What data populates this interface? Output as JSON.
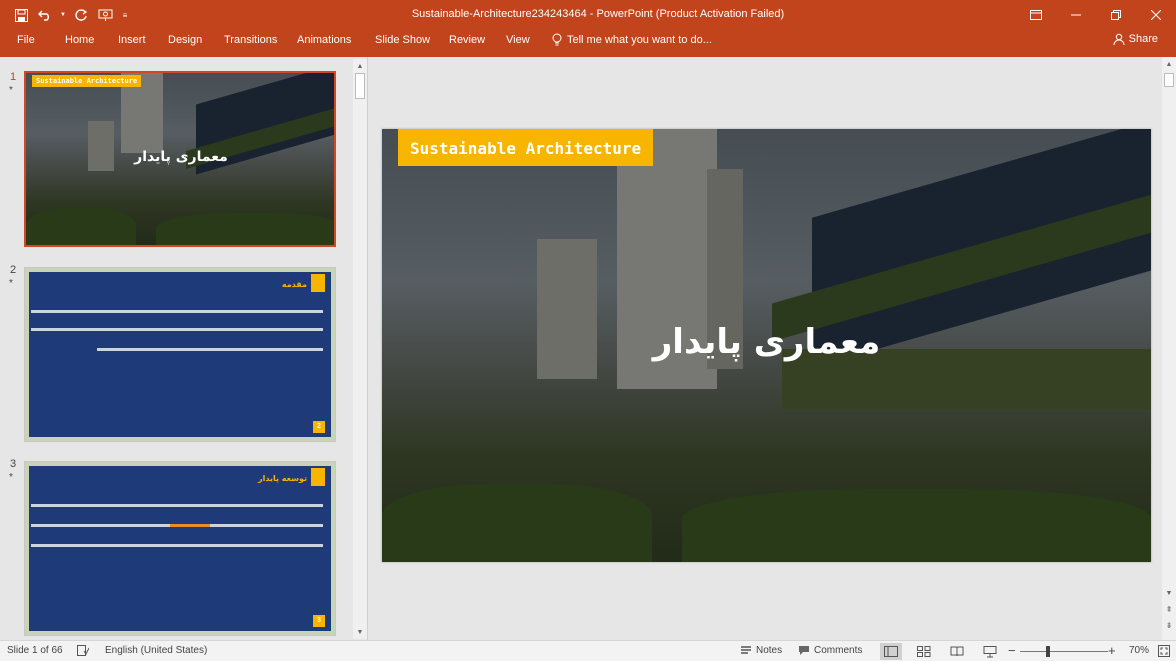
{
  "window": {
    "title": "Sustainable-Architecture234243464 - PowerPoint (Product Activation Failed)"
  },
  "ribbon": {
    "tabs": [
      "File",
      "Home",
      "Insert",
      "Design",
      "Transitions",
      "Animations",
      "Slide Show",
      "Review",
      "View"
    ],
    "tell_me": "Tell me what you want to do...",
    "share": "Share"
  },
  "thumbnails": [
    {
      "number": "1",
      "star": "*",
      "tag": "Sustainable Architecture",
      "title": "معماری پایدار"
    },
    {
      "number": "2",
      "star": "*",
      "heading": "مقدمه",
      "page": "2"
    },
    {
      "number": "3",
      "star": "*",
      "heading": "توسعه پایدار",
      "page": "3"
    }
  ],
  "main_slide": {
    "tag": "Sustainable Architecture",
    "title": "معماری پایدار"
  },
  "status": {
    "slide_info": "Slide 1 of 66",
    "language": "English (United States)",
    "notes": "Notes",
    "comments": "Comments",
    "zoom_minus": "−",
    "zoom_plus": "+",
    "zoom": "70%"
  },
  "colors": {
    "accent": "#c2441c",
    "selection": "#d24726",
    "tag_yellow": "#f7b500",
    "slide_navy": "#1f3a78"
  }
}
